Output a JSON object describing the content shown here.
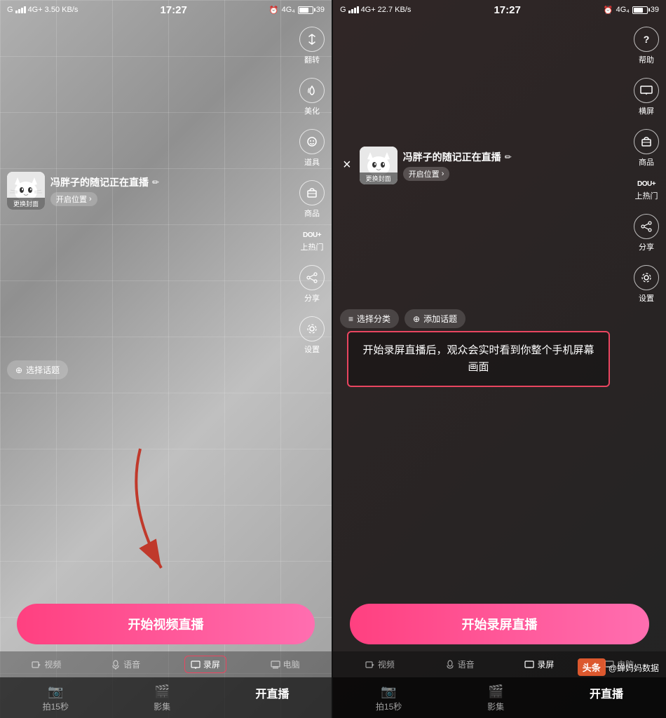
{
  "left_phone": {
    "status": {
      "carrier": "G",
      "network": "4G+",
      "speed": "3.50 KB/s",
      "time": "17:27",
      "alarm_icon": "⏰",
      "network_type": "4G₄",
      "battery_pct": "39"
    },
    "header": {
      "profile_name": "冯胖子的随记正在直播",
      "edit_icon": "✏",
      "change_cover": "更换封面",
      "location_label": "开启位置",
      "location_arrow": "›"
    },
    "right_icons": [
      {
        "id": "flip",
        "icon": "↕",
        "unicode": "⟳",
        "label": "翻转"
      },
      {
        "id": "beauty",
        "icon": "✨",
        "label": "美化"
      },
      {
        "id": "props",
        "icon": "😊",
        "label": "道具"
      },
      {
        "id": "goods",
        "icon": "🛒",
        "label": "商品"
      },
      {
        "id": "dou",
        "icon": "DOU+",
        "label": "上热门"
      },
      {
        "id": "share",
        "icon": "↗",
        "label": "分享"
      },
      {
        "id": "settings",
        "icon": "⚙",
        "label": "设置"
      }
    ],
    "topic": {
      "icon": "⊕",
      "label": "选择话题"
    },
    "start_button": "开始视频直播",
    "mode_tabs": [
      {
        "id": "video",
        "icon": "□",
        "label": "视频",
        "active": false
      },
      {
        "id": "voice",
        "icon": "♪",
        "label": "语音",
        "active": false
      },
      {
        "id": "screen",
        "icon": "□",
        "label": "录屏",
        "active": true,
        "selected": true
      },
      {
        "id": "pc",
        "icon": "□",
        "label": "电脑",
        "active": false
      }
    ],
    "bottom_nav": [
      {
        "id": "capture",
        "label": "拍15秒",
        "active": false
      },
      {
        "id": "album",
        "label": "影集",
        "active": false
      },
      {
        "id": "live",
        "label": "开直播",
        "active": true
      }
    ]
  },
  "right_phone": {
    "status": {
      "carrier": "G",
      "network": "4G+",
      "speed": "22.7 KB/s",
      "time": "17:27",
      "alarm_icon": "⏰",
      "network_type": "4G₄",
      "battery_pct": "39"
    },
    "header": {
      "close_icon": "×",
      "profile_name": "冯胖子的随记正在直播",
      "edit_icon": "✏",
      "change_cover": "更换封面",
      "location_label": "开启位置",
      "location_arrow": "›"
    },
    "right_icons": [
      {
        "id": "help",
        "icon": "?",
        "label": "帮助"
      },
      {
        "id": "screen_cast",
        "icon": "⬜",
        "label": "横屏"
      },
      {
        "id": "goods",
        "icon": "🛒",
        "label": "商品"
      },
      {
        "id": "dou",
        "icon": "DOU+",
        "label": "上热门"
      },
      {
        "id": "share",
        "icon": "↗",
        "label": "分享"
      },
      {
        "id": "settings",
        "icon": "⚙",
        "label": "设置"
      }
    ],
    "category": {
      "icon": "≡",
      "label": "选择分类"
    },
    "hashtag": {
      "icon": "⊕",
      "label": "添加话题"
    },
    "warning": {
      "text": "开始录屏直播后，观众会实时看到你整个手机屏幕画面"
    },
    "start_button": "开始录屏直播",
    "mode_tabs": [
      {
        "id": "video",
        "icon": "□",
        "label": "视频",
        "active": false
      },
      {
        "id": "voice",
        "icon": "♪",
        "label": "语音",
        "active": false
      },
      {
        "id": "screen",
        "icon": "□",
        "label": "录屏",
        "active": true
      },
      {
        "id": "pc",
        "icon": "□",
        "label": "电脑",
        "active": false
      }
    ],
    "bottom_nav": [
      {
        "id": "capture",
        "label": "拍15秒",
        "active": false
      },
      {
        "id": "album",
        "label": "影集",
        "active": false
      },
      {
        "id": "live",
        "label": "开直播",
        "active": true
      }
    ]
  },
  "watermark": {
    "logo": "头条",
    "handle": "@蝉妈妈数据"
  },
  "arrow": {
    "color": "#c0392b"
  }
}
